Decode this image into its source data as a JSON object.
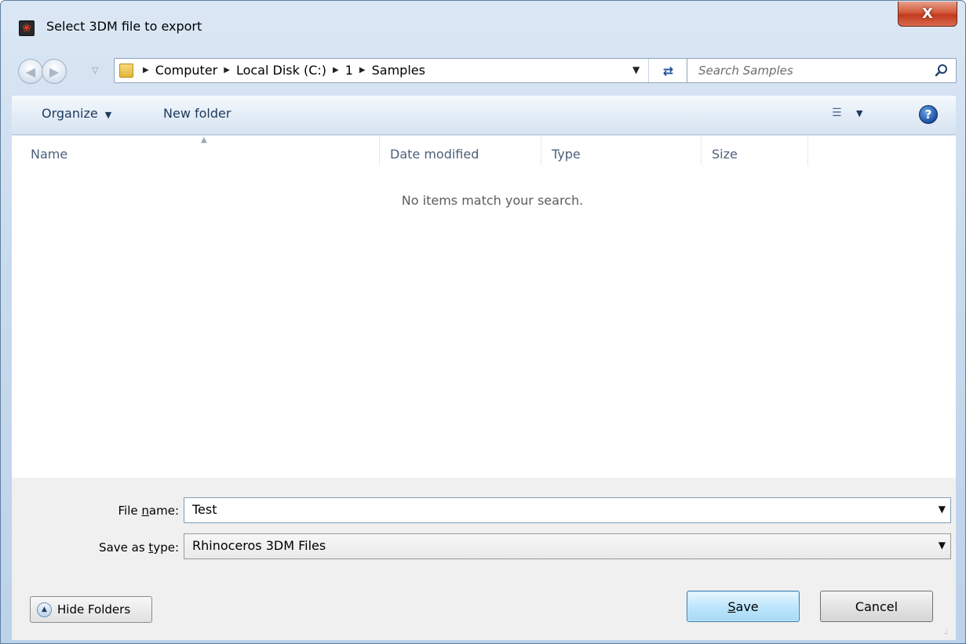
{
  "window": {
    "title": "Select 3DM file to export",
    "close_glyph": "X"
  },
  "nav": {
    "breadcrumbs": [
      "Computer",
      "Local Disk (C:)",
      "1",
      "Samples"
    ],
    "search_placeholder": "Search Samples"
  },
  "toolbar": {
    "organize_label": "Organize",
    "new_folder_label": "New folder",
    "help_glyph": "?"
  },
  "file_list": {
    "columns": [
      "Name",
      "Date modified",
      "Type",
      "Size"
    ],
    "empty_message": "No items match your search."
  },
  "form": {
    "file_name_label_pre": "File ",
    "file_name_label_u": "n",
    "file_name_label_post": "ame:",
    "file_name_value": "Test",
    "save_type_label_pre": "Save as ",
    "save_type_label_u": "t",
    "save_type_label_post": "ype:",
    "save_type_value": "Rhinoceros 3DM Files"
  },
  "buttons": {
    "hide_folders": "Hide Folders",
    "save_u": "S",
    "save_rest": "ave",
    "cancel": "Cancel"
  },
  "colors": {
    "accent": "#3c7fb1",
    "close_red": "#c23a1d"
  }
}
